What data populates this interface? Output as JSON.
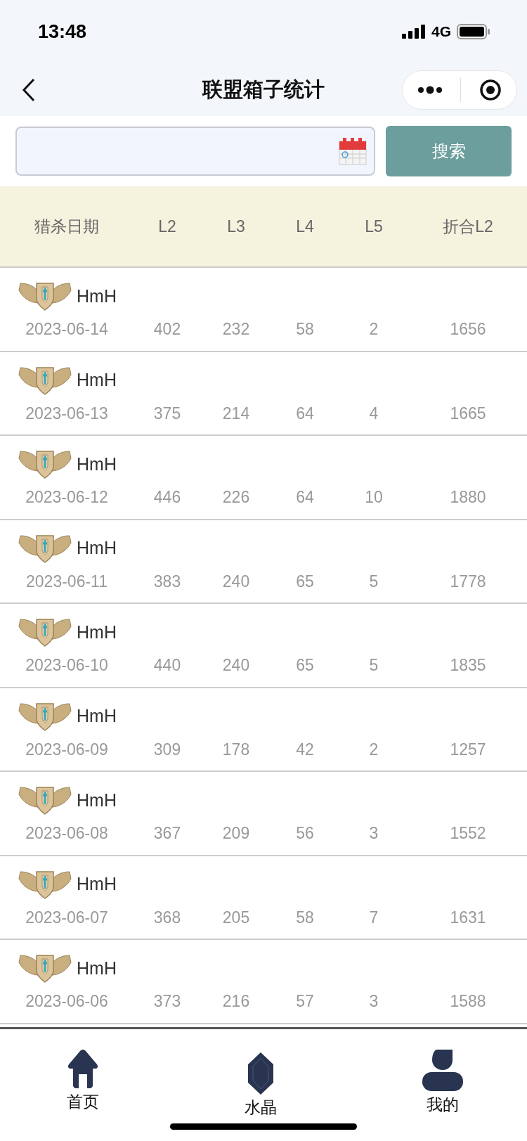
{
  "status_bar": {
    "time": "13:48",
    "network": "4G"
  },
  "nav_bar": {
    "title": "联盟箱子统计"
  },
  "search": {
    "button": "搜索"
  },
  "table": {
    "columns": [
      "猎杀日期",
      "L2",
      "L3",
      "L4",
      "L5",
      "折合L2"
    ],
    "rows": [
      {
        "name": "HmH",
        "cells": [
          "2023-06-14",
          "402",
          "232",
          "58",
          "2",
          "1656"
        ]
      },
      {
        "name": "HmH",
        "cells": [
          "2023-06-13",
          "375",
          "214",
          "64",
          "4",
          "1665"
        ]
      },
      {
        "name": "HmH",
        "cells": [
          "2023-06-12",
          "446",
          "226",
          "64",
          "10",
          "1880"
        ]
      },
      {
        "name": "HmH",
        "cells": [
          "2023-06-11",
          "383",
          "240",
          "65",
          "5",
          "1778"
        ]
      },
      {
        "name": "HmH",
        "cells": [
          "2023-06-10",
          "440",
          "240",
          "65",
          "5",
          "1835"
        ]
      },
      {
        "name": "HmH",
        "cells": [
          "2023-06-09",
          "309",
          "178",
          "42",
          "2",
          "1257"
        ]
      },
      {
        "name": "HmH",
        "cells": [
          "2023-06-08",
          "367",
          "209",
          "56",
          "3",
          "1552"
        ]
      },
      {
        "name": "HmH",
        "cells": [
          "2023-06-07",
          "368",
          "205",
          "58",
          "7",
          "1631"
        ]
      },
      {
        "name": "HmH",
        "cells": [
          "2023-06-06",
          "373",
          "216",
          "57",
          "3",
          "1588"
        ]
      }
    ]
  },
  "tab_bar": [
    {
      "kind": "home",
      "label": "首页"
    },
    {
      "kind": "crystal",
      "label": "水晶"
    },
    {
      "kind": "profile",
      "label": "我的"
    }
  ]
}
